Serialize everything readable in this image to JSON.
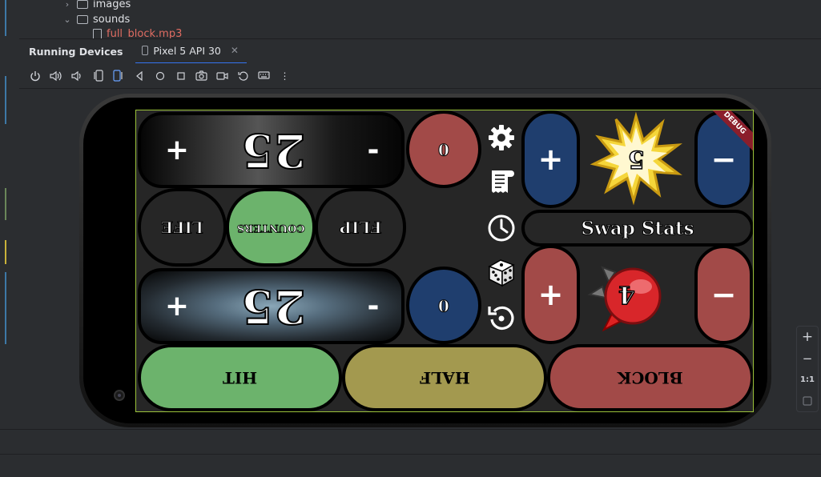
{
  "tree": {
    "images_label": "images",
    "sounds_label": "sounds",
    "file_label": "full_block.mp3"
  },
  "tool_window": {
    "title": "Running Devices",
    "device_tab": "Pixel 5 API 30"
  },
  "zoom": {
    "plus": "+",
    "minus": "−",
    "ratio": "1:1"
  },
  "game": {
    "debug_banner": "DEBUG",
    "top_life": {
      "value": "25",
      "plus": "+",
      "minus": "-"
    },
    "bottom_life": {
      "value": "25",
      "plus": "+",
      "minus": "-"
    },
    "top_counter": "0",
    "bottom_counter": "0",
    "buttons": {
      "life": "LIFE",
      "counters": "COUNTERS",
      "flip": "FLIP",
      "hit": "HIT",
      "half": "HALF",
      "block": "BLOCK",
      "swap_stats": "Swap Stats"
    },
    "attack_stat": {
      "value": "5",
      "plus": "+",
      "minus": "−"
    },
    "defense_stat": {
      "value": "4",
      "plus": "+",
      "minus": "−"
    },
    "colors": {
      "red": "#a24a48",
      "blue": "#1f3e6e",
      "green": "#6cb36c",
      "olive": "#a3994f",
      "screen_bg": "#262626"
    }
  }
}
